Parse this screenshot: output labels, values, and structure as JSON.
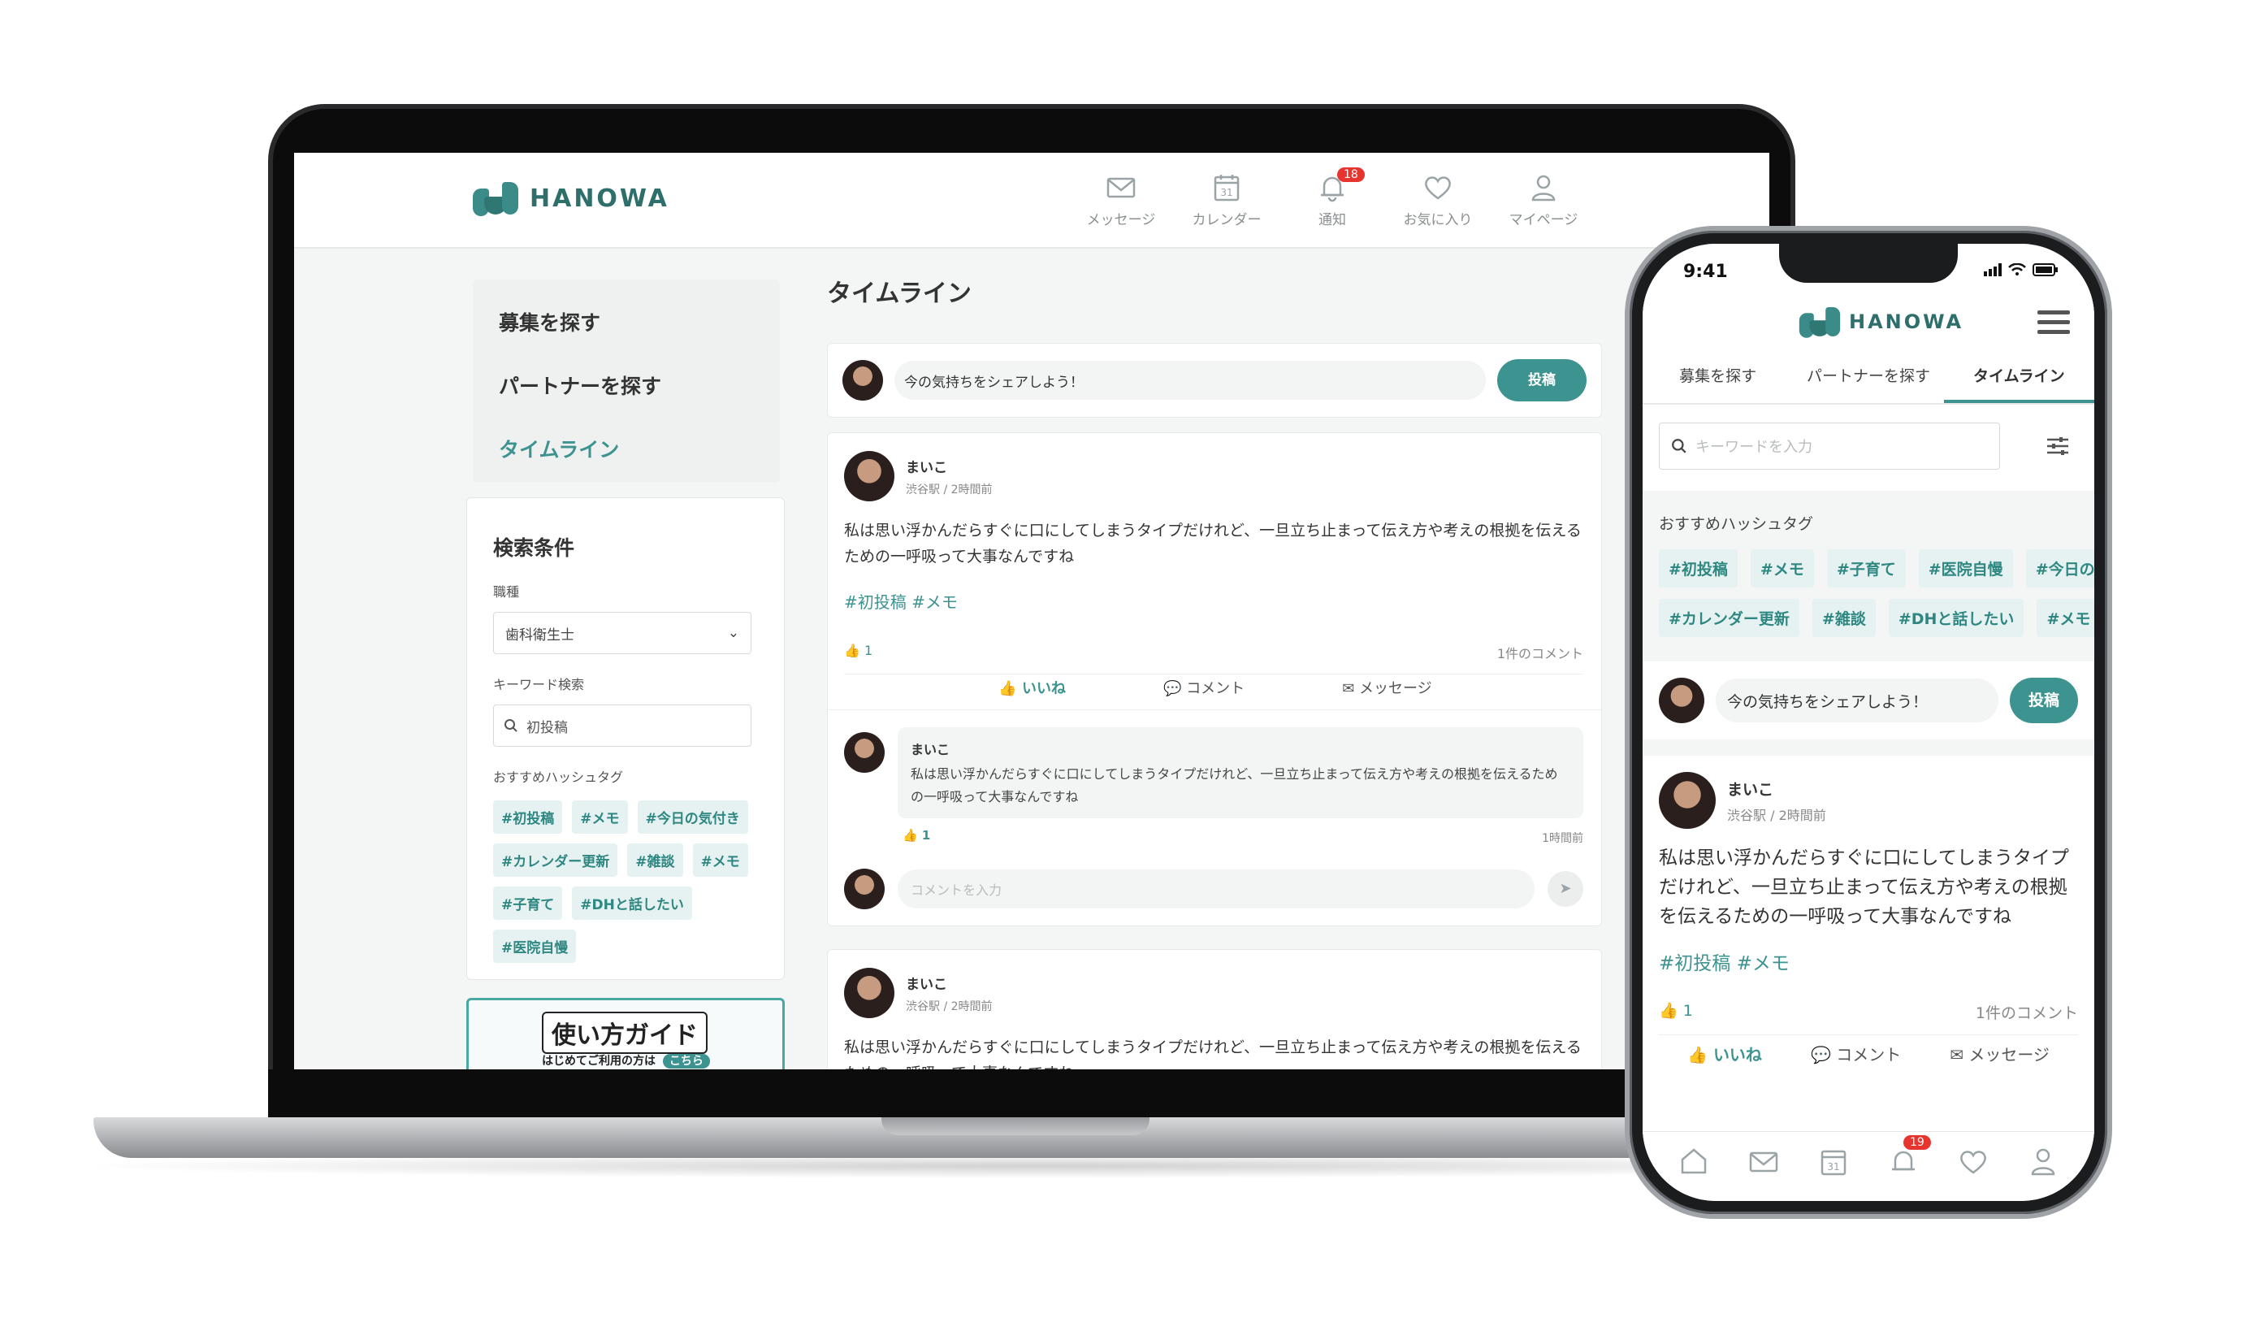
{
  "brand": {
    "name": "HANOWA",
    "accent": "#3d938f"
  },
  "desktop": {
    "nav": [
      {
        "label": "メッセージ",
        "icon": "mail-icon"
      },
      {
        "label": "カレンダー",
        "icon": "calendar-icon"
      },
      {
        "label": "通知",
        "icon": "bell-icon",
        "badge": "18"
      },
      {
        "label": "お気に入り",
        "icon": "heart-icon"
      },
      {
        "label": "マイページ",
        "icon": "user-icon"
      }
    ],
    "side_menu": [
      "募集を探す",
      "パートナーを探す",
      "タイムライン"
    ],
    "search": {
      "title": "検索条件",
      "job_label": "職種",
      "job_value": "歯科衛生士",
      "keyword_label": "キーワード検索",
      "keyword_value": "初投稿",
      "tags_label": "おすすめハッシュタグ",
      "tags": [
        "#初投稿",
        "#メモ",
        "#今日の気付き",
        "#カレンダー更新",
        "#雑談",
        "#メモ",
        "#子育て",
        "#DHと話したい",
        "#医院自慢"
      ]
    },
    "banner": {
      "title": "使い方ガイド",
      "subtitle": "はじめてご利用の方は",
      "cta": "こちら"
    },
    "timeline_title": "タイムライン",
    "share_placeholder": "今の気持ちをシェアしよう！",
    "post_button": "投稿",
    "post": {
      "name": "まいこ",
      "meta": "渋谷駅 / 2時間前",
      "body": "私は思い浮かんだらすぐに口にしてしまうタイプだけれど、一旦立ち止まって伝え方や考えの根拠を伝えるための一呼吸って大事なんですね",
      "tags": "#初投稿 #メモ",
      "likes": "1",
      "comments_count": "1件のコメント",
      "like_label": "いいね",
      "comment_label": "コメント",
      "message_label": "メッセージ",
      "comment": {
        "name": "まいこ",
        "text": "私は思い浮かんだらすぐに口にしてしまうタイプだけれど、一旦立ち止まって伝え方や考えの根拠を伝えるための一呼吸って大事なんですね",
        "likes": "1",
        "time": "1時間前"
      },
      "comment_placeholder": "コメントを入力"
    },
    "post2": {
      "name": "まいこ",
      "meta": "渋谷駅 / 2時間前",
      "body": "私は思い浮かんだらすぐに口にしてしまうタイプだけれど、一旦立ち止まって伝え方や考えの根拠を伝えるための一呼吸って大事なんですね"
    }
  },
  "mobile": {
    "status_time": "9:41",
    "tabs": [
      "募集を探す",
      "パートナーを探す",
      "タイムライン"
    ],
    "search_placeholder": "キーワードを入力",
    "tags_label": "おすすめハッシュタグ",
    "tags": [
      "#初投稿",
      "#メモ",
      "#子育て",
      "#医院自慢",
      "#今日の",
      "#カレンダー更新",
      "#雑談",
      "#DHと話したい",
      "#メモ"
    ],
    "share_placeholder": "今の気持ちをシェアしよう！",
    "post_button": "投稿",
    "post": {
      "name": "まいこ",
      "meta": "渋谷駅 / 2時間前",
      "body": "私は思い浮かんだらすぐに口にしてしまうタイプだけれど、一旦立ち止まって伝え方や考えの根拠を伝えるための一呼吸って大事なんですね",
      "tags": "#初投稿 #メモ",
      "likes": "1",
      "comments_count": "1件のコメント",
      "like_label": "いいね",
      "comment_label": "コメント",
      "message_label": "メッセージ"
    },
    "bottom_nav_badge": "19"
  }
}
